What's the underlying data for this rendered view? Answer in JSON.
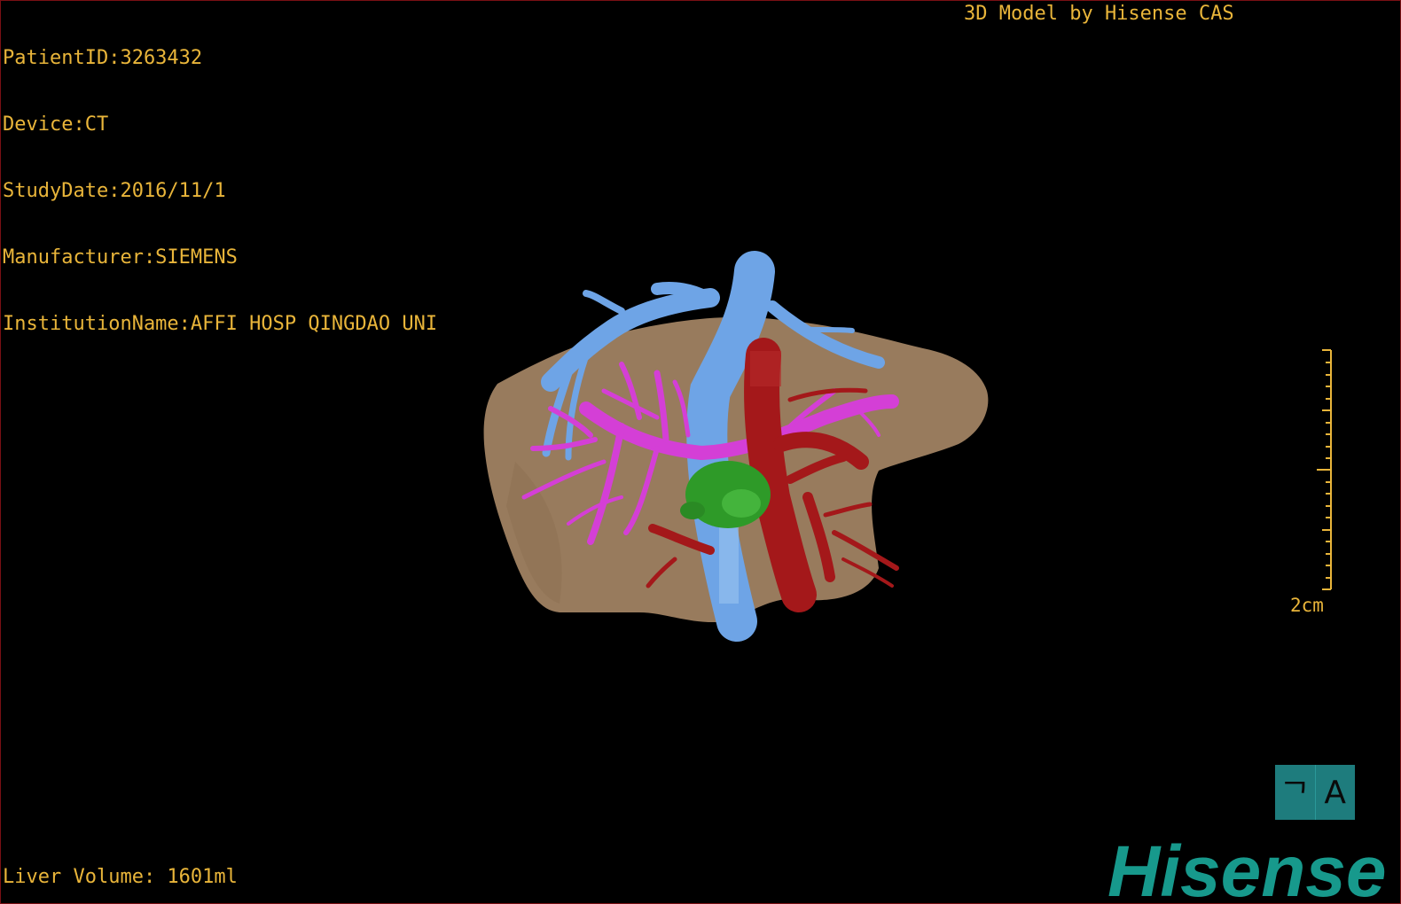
{
  "meta": {
    "patient_id": "PatientID:3263432",
    "device": "Device:CT",
    "study_date": "StudyDate:2016/11/1",
    "manufacturer": "Manufacturer:SIEMENS",
    "institution": "InstitutionName:AFFI HOSP QINGDAO UNI"
  },
  "brand_title": "3D Model by Hisense CAS",
  "liver_volume": "Liver Volume: 1601ml",
  "scale": {
    "label": "2cm"
  },
  "orientation": {
    "left_glyph": "ᄀ",
    "right_glyph": "A"
  },
  "logo": "Hisense",
  "colors": {
    "text": "#e9b53a",
    "liver": "#a08262",
    "hepatic_vein": "#6ea4e6",
    "portal_vein": "#d43fd6",
    "artery": "#a4181a",
    "tumor": "#2e9a28",
    "brand": "#17998c"
  },
  "icons": {
    "scale_bar": "ruler-icon",
    "orientation": "orientation-icon"
  }
}
